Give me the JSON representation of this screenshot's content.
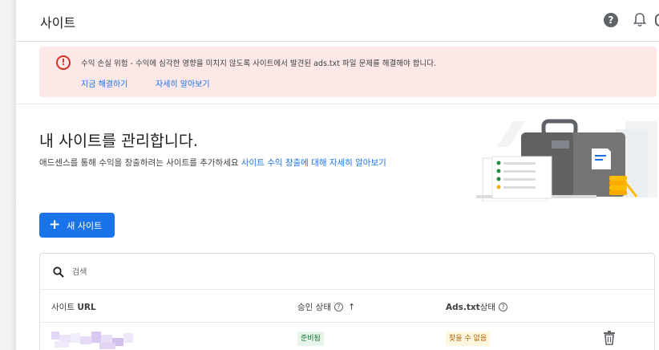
{
  "header": {
    "title": "사이트",
    "help_glyph": "?",
    "icons": [
      "help-icon",
      "bell-icon",
      "more-vert-icon"
    ]
  },
  "alert": {
    "icon_glyph": "!",
    "message": "수익 손실 위험 - 수익에 심각한 영향을 미치지 않도록 사이트에서 발견된 ads.txt 파일 문제를 해결해야 합니다.",
    "fix_link": "지금 해결하기",
    "learn_link": "자세히 알아보기",
    "color": "#fce8e6",
    "icon_color": "#d93025"
  },
  "intro": {
    "headline": "내 사이트를 관리합니다.",
    "subtext": "애드센스를 통해 수익을 창출하려는 사이트를 추가하세요 ",
    "subtext_link": "사이트 수익 창출에 대해 자세히 알아보기"
  },
  "new_site_button": {
    "plus": "+",
    "label": "새 사이트",
    "color": "#1a73e8"
  },
  "table": {
    "search": {
      "placeholder": "검색",
      "value": ""
    },
    "columns": {
      "url_prefix": "사이트 ",
      "url_bold": "URL",
      "approval": "승인 상태",
      "adstxt_bold": "Ads.txt",
      "adstxt_suffix": " 상태",
      "info_glyph": "?",
      "sort_glyph": "↑"
    },
    "rows": [
      {
        "approval_status": "준비됨",
        "adstxt_status": "찾을 수 없음"
      }
    ]
  },
  "colors": {
    "accent": "#1a73e8",
    "ready_bg": "#e6f4ea",
    "ready_text": "#137333",
    "warn_bg": "#fef7e0",
    "warn_text": "#b06000"
  }
}
